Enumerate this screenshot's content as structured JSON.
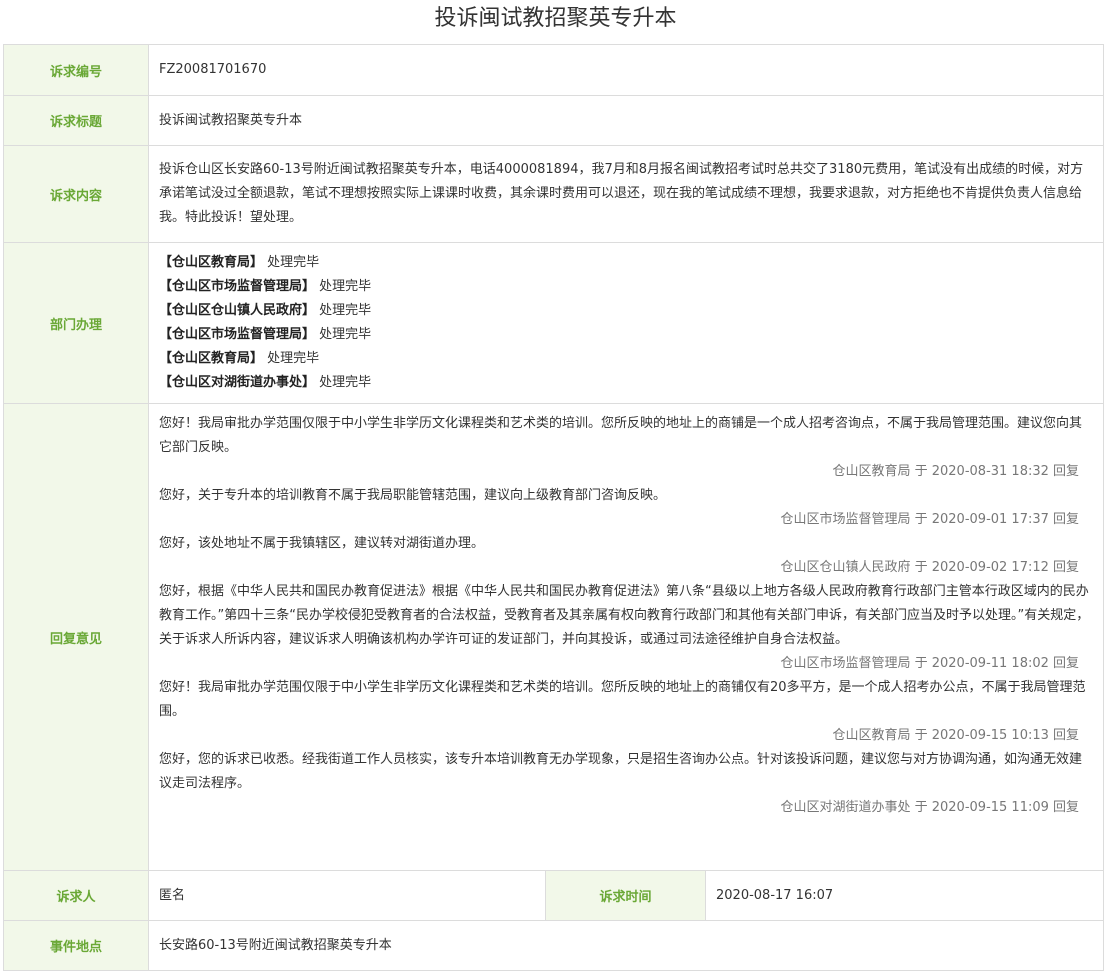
{
  "title": "投诉闽试教招聚英专升本",
  "rows": {
    "code": {
      "label": "诉求编号",
      "value": "FZ20081701670"
    },
    "subject": {
      "label": "诉求标题",
      "value": "投诉闽试教招聚英专升本"
    },
    "content": {
      "label": "诉求内容",
      "value": "投诉仓山区长安路60-13号附近闽试教招聚英专升本，电话4000081894，我7月和8月报名闽试教招考试时总共交了3180元费用，笔试没有出成绩的时候，对方承诺笔试没过全额退款，笔试不理想按照实际上课课时收费，其余课时费用可以退还，现在我的笔试成绩不理想，我要求退款，对方拒绝也不肯提供负责人信息给我。特此投诉！望处理。"
    },
    "departments": {
      "label": "部门办理",
      "items": [
        {
          "name": "【仓山区教育局】",
          "status": "处理完毕"
        },
        {
          "name": "【仓山区市场监督管理局】",
          "status": "处理完毕"
        },
        {
          "name": "【仓山区仓山镇人民政府】",
          "status": "处理完毕"
        },
        {
          "name": "【仓山区市场监督管理局】",
          "status": "处理完毕"
        },
        {
          "name": "【仓山区教育局】",
          "status": "处理完毕"
        },
        {
          "name": "【仓山区对湖街道办事处】",
          "status": "处理完毕"
        }
      ]
    },
    "replies": {
      "label": "回复意见",
      "items": [
        {
          "text": "您好！我局审批办学范围仅限于中小学生非学历文化课程类和艺术类的培训。您所反映的地址上的商铺是一个成人招考咨询点，不属于我局管理范围。建议您向其它部门反映。",
          "meta": "仓山区教育局 于 2020-08-31 18:32 回复"
        },
        {
          "text": "您好，关于专升本的培训教育不属于我局职能管辖范围，建议向上级教育部门咨询反映。",
          "meta": "仓山区市场监督管理局 于 2020-09-01 17:37 回复"
        },
        {
          "text": "您好，该处地址不属于我镇辖区，建议转对湖街道办理。",
          "meta": "仓山区仓山镇人民政府 于 2020-09-02 17:12 回复"
        },
        {
          "text": "您好，根据《中华人民共和国民办教育促进法》根据《中华人民共和国民办教育促进法》第八条“县级以上地方各级人民政府教育行政部门主管本行政区域内的民办教育工作。”第四十三条“民办学校侵犯受教育者的合法权益，受教育者及其亲属有权向教育行政部门和其他有关部门申诉，有关部门应当及时予以处理。”有关规定，关于诉求人所诉内容，建议诉求人明确该机构办学许可证的发证部门，并向其投诉，或通过司法途径维护自身合法权益。",
          "meta": "仓山区市场监督管理局 于 2020-09-11 18:02 回复"
        },
        {
          "text": "您好！我局审批办学范围仅限于中小学生非学历文化课程类和艺术类的培训。您所反映的地址上的商铺仅有20多平方，是一个成人招考办公点，不属于我局管理范围。",
          "meta": "仓山区教育局 于 2020-09-15 10:13 回复"
        },
        {
          "text": "您好，您的诉求已收悉。经我街道工作人员核实，该专升本培训教育无办学现象，只是招生咨询办公点。针对该投诉问题，建议您与对方协调沟通，如沟通无效建议走司法程序。",
          "meta": "仓山区对湖街道办事处 于 2020-09-15 11:09 回复"
        }
      ]
    },
    "requester": {
      "label": "诉求人",
      "value": "匿名"
    },
    "request_time": {
      "label": "诉求时间",
      "value": "2020-08-17 16:07"
    },
    "location": {
      "label": "事件地点",
      "value": "长安路60-13号附近闽试教招聚英专升本"
    }
  },
  "colors": {
    "label_bg": "#f2f8e9",
    "label_text": "#6aa836",
    "border": "#dcdcdc",
    "meta_text": "#777777"
  }
}
